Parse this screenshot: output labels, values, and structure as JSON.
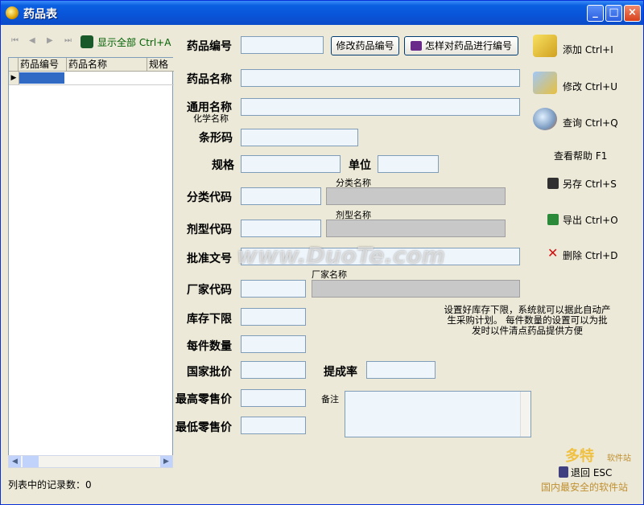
{
  "window": {
    "title": "药品表",
    "controls": [
      "_",
      "□",
      "×"
    ]
  },
  "navigator": {
    "buttons": [
      "⏮",
      "◀",
      "▶",
      "⏭"
    ],
    "show_all_label": "显示全部 Ctrl+A"
  },
  "grid": {
    "columns": [
      "药品编号",
      "药品名称",
      "规格"
    ],
    "rows": [
      [
        "",
        "",
        ""
      ]
    ]
  },
  "status": {
    "records_label": "列表中的记录数：0"
  },
  "form": {
    "drug_code_label": "药品编号",
    "drug_code_value": "",
    "modify_code_button": "修改药品编号",
    "how_to_code_button": "怎样对药品进行编号",
    "drug_name_label": "药品名称",
    "generic_name_label": "通用名称",
    "chemical_name_label": "化学名称",
    "barcode_label": "条形码",
    "spec_label": "规格",
    "unit_label": "单位",
    "category_code_label": "分类代码",
    "category_name_label": "分类名称",
    "dosage_code_label": "剂型代码",
    "dosage_name_label": "剂型名称",
    "approval_label": "批准文号",
    "maker_code_label": "厂家代码",
    "maker_name_label": "厂家名称",
    "min_stock_label": "库存下限",
    "per_box_label": "每件数量",
    "state_price_label": "国家批价",
    "commission_label": "提成率",
    "max_retail_label": "最高零售价",
    "notes_label": "备注",
    "min_retail_label": "最低零售价",
    "hint": "设置好库存下限，系统就可以据此自动产生采购计划。  每件数量的设置可以为批发时以件清点药品提供方便"
  },
  "actions": {
    "add": "添加 Ctrl+I",
    "edit": "修改 Ctrl+U",
    "query": "查询 Ctrl+Q",
    "help": "查看帮助 F1",
    "save_as": "另存 Ctrl+S",
    "export": "导出 Ctrl+O",
    "delete": "删除 Ctrl+D",
    "back": "退回 ESC"
  },
  "watermark": {
    "site": "www.DuoTe.com",
    "brand": "多特",
    "brand_tag": "软件站",
    "slogan": "国内最安全的软件站"
  }
}
